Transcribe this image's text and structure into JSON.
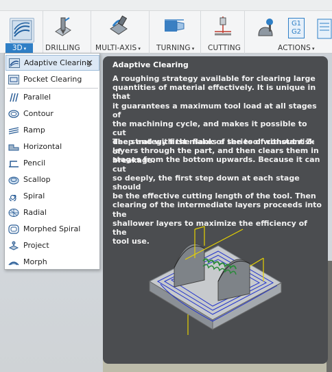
{
  "ribbon": {
    "tab_3d": "3D",
    "drilling": "DRILLING",
    "multi_axis": "MULTI-AXIS",
    "turning": "TURNING",
    "cutting": "CUTTING",
    "actions": "ACTIONS",
    "g1": "G1",
    "g2": "G2",
    "caret": "▾"
  },
  "menu": {
    "items": [
      {
        "label": "Adaptive Clearing",
        "icon": "adaptive-clearing-icon"
      },
      {
        "label": "Pocket Clearing",
        "icon": "pocket-clearing-icon"
      },
      {
        "label": "Parallel",
        "icon": "parallel-icon"
      },
      {
        "label": "Contour",
        "icon": "contour-icon"
      },
      {
        "label": "Ramp",
        "icon": "ramp-icon"
      },
      {
        "label": "Horizontal",
        "icon": "horizontal-icon"
      },
      {
        "label": "Pencil",
        "icon": "pencil-icon"
      },
      {
        "label": "Scallop",
        "icon": "scallop-icon"
      },
      {
        "label": "Spiral",
        "icon": "spiral-icon"
      },
      {
        "label": "Radial",
        "icon": "radial-icon"
      },
      {
        "label": "Morphed Spiral",
        "icon": "morphed-spiral-icon"
      },
      {
        "label": "Project",
        "icon": "project-icon"
      },
      {
        "label": "Morph",
        "icon": "morph-icon"
      }
    ],
    "close_glyph": "✕"
  },
  "tooltip": {
    "title": "Adaptive Clearing",
    "p1_lines": [
      "A roughing strategy available for clearing large",
      "quantities of material effectively. It is unique in that",
      "it guarantees a maximum tool load at all stages of",
      "the machining cycle, and makes it possible to cut",
      "deep and with the flank of the tool without risk of",
      "breakage."
    ],
    "p2_lines": [
      "The strategy first makes a series of constant Z-",
      "layers through the part, and then clears them in",
      "stages from the bottom upwards. Because it can cut",
      "so deeply, the first step down at each stage should",
      "be the effective cutting length of the tool. Then",
      "clearing of the intermediate layers proceeds into the",
      "shallower layers to maximize the efficiency of the",
      "tool use."
    ]
  },
  "colors": {
    "accent": "#2f7fc6",
    "tooltip_bg": "#4b4d50",
    "toolpath": "#2233cc"
  }
}
